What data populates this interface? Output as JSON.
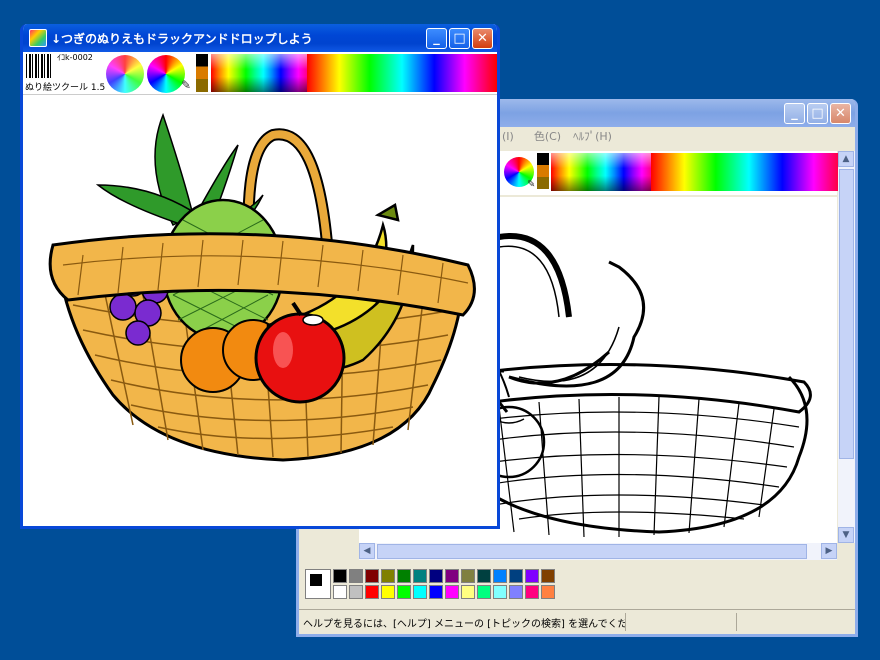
{
  "front_window": {
    "title": "↓つぎのぬりえもドラックアンドドロップしよう",
    "tool_code": "ｲｺk-0002",
    "tool_name": "ぬり絵ツクール 1.5"
  },
  "back_window": {
    "menu": [
      "ﾍﾙﾌﾟ(H)",
      "色(C)"
    ],
    "menu_partial": "(I)",
    "status_text": "ヘルプを見るには、[ヘルプ] メニューの [トピックの検索] を選んでください。"
  },
  "palette": [
    "#000000",
    "#808080",
    "#800000",
    "#808000",
    "#008000",
    "#008080",
    "#000080",
    "#800080",
    "#808040",
    "#004040",
    "#0080ff",
    "#004080",
    "#8000ff",
    "#804000",
    "#ffffff",
    "#c0c0c0",
    "#ff0000",
    "#ffff00",
    "#00ff00",
    "#00ffff",
    "#0000ff",
    "#ff00ff",
    "#ffff80",
    "#00ff80",
    "#80ffff",
    "#8080ff",
    "#ff0080",
    "#ff8040"
  ],
  "icons": {
    "minimize": "minimize-icon",
    "maximize": "maximize-icon",
    "close": "close-icon",
    "eyedropper": "eyedropper-icon"
  }
}
